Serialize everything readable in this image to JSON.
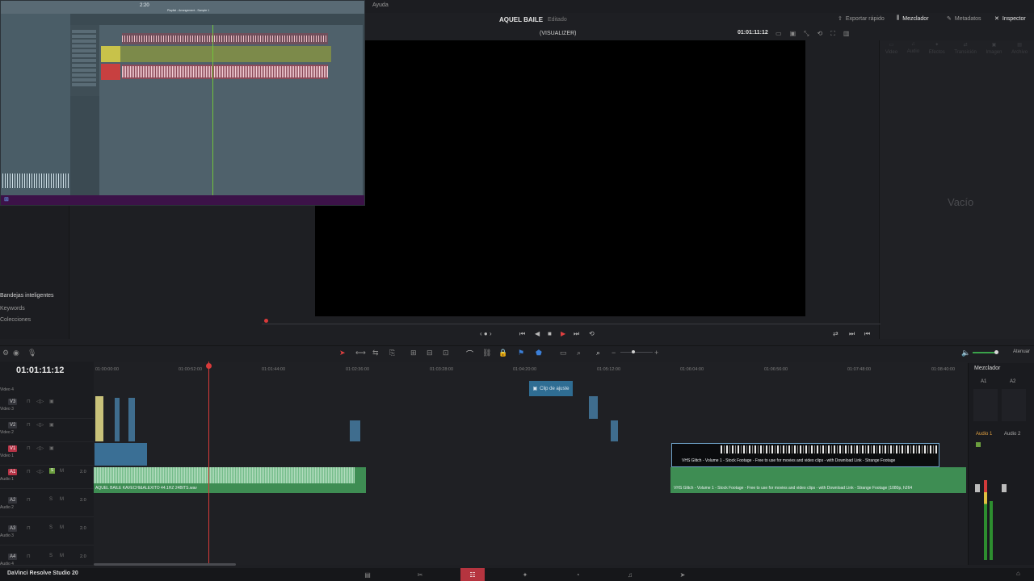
{
  "menu": {
    "help": "Ayuda"
  },
  "project": {
    "title": "AQUEL BAILE",
    "status": "Editado"
  },
  "header_buttons": [
    {
      "label": "Exportar rápido",
      "active": false
    },
    {
      "label": "Mezclador",
      "active": true
    },
    {
      "label": "Metadatos",
      "active": false
    },
    {
      "label": "Inspector",
      "active": true
    }
  ],
  "viewer": {
    "name": "(VISUALIZER)",
    "timecode": "01:01:11:12"
  },
  "inspector": {
    "tabs": [
      "Video",
      "Audio",
      "Efectos",
      "Transición",
      "Imagen",
      "Archivo"
    ],
    "empty_text": "Vacío"
  },
  "media_pool": {
    "smart_bins_header": "Bandejas inteligentes",
    "items": [
      "Keywords",
      "Colecciones"
    ]
  },
  "timeline": {
    "timecode": "01:01:11:12",
    "ruler": [
      "01:00:00:00",
      "01:00:52:00",
      "01:01:44:00",
      "01:02:36:00",
      "01:03:28:00",
      "01:04:20:00",
      "01:05:12:00",
      "01:06:04:00",
      "01:06:56:00",
      "01:07:48:00",
      "01:08:40:00"
    ],
    "tracks": [
      {
        "name": "V3",
        "cut": "Video 3",
        "type": "video"
      },
      {
        "name": "V2",
        "cut": "Video 2",
        "type": "video"
      },
      {
        "name": "V1",
        "cut": "Video 1",
        "type": "video"
      },
      {
        "name": "A1",
        "cut": "Audio 1",
        "type": "audio",
        "value": "2.0",
        "active": true
      },
      {
        "name": "A2",
        "cut": "Audio 2",
        "type": "audio",
        "value": "2.0"
      },
      {
        "name": "A3",
        "cut": "Audio 3",
        "type": "audio",
        "value": "2.0"
      },
      {
        "name": "A4",
        "cut": "Audio 4",
        "type": "audio",
        "value": "2.0"
      }
    ],
    "top_cut_label": "Video 4",
    "adjustment_clip": "Clip de ajuste",
    "audio_clip_1": "AQUEL BAILE KAVECHI&ALEXITO 44.1HZ 24BITS.wav",
    "video_clip_2": "VHS Glitch - Volume 1 - Stock Footage - Free to use for movies and video clips - with Download Link - Strange Footage",
    "audio_clip_2": "VHS Glitch - Volume 1 - Stock Footage - Free to use for movies and video clips - with Download Link - Strange Footage (1080p, h264"
  },
  "toolbar": {
    "volume_label": "Atenuar"
  },
  "mixer": {
    "title": "Mezclador",
    "channels": [
      "A1",
      "A2"
    ],
    "buses": [
      "Audio 1",
      "Audio 2"
    ],
    "levels": {
      "audio1": 0.75,
      "audio2": 0.55
    }
  },
  "fl_studio": {
    "time": "2:20",
    "playlist_title": "Playlist - Arrangement - Sample 1"
  },
  "bottom": {
    "app_name": "DaVinci Resolve Studio 20"
  },
  "pages": [
    {
      "name": "media-icon",
      "glyph": "▤"
    },
    {
      "name": "cut-icon",
      "glyph": "✂"
    },
    {
      "name": "edit-icon",
      "glyph": "☷",
      "active": true
    },
    {
      "name": "fusion-icon",
      "glyph": "✦"
    },
    {
      "name": "color-icon",
      "glyph": "◔"
    },
    {
      "name": "fairlight-icon",
      "glyph": "♫"
    },
    {
      "name": "deliver-icon",
      "glyph": "➤"
    }
  ]
}
